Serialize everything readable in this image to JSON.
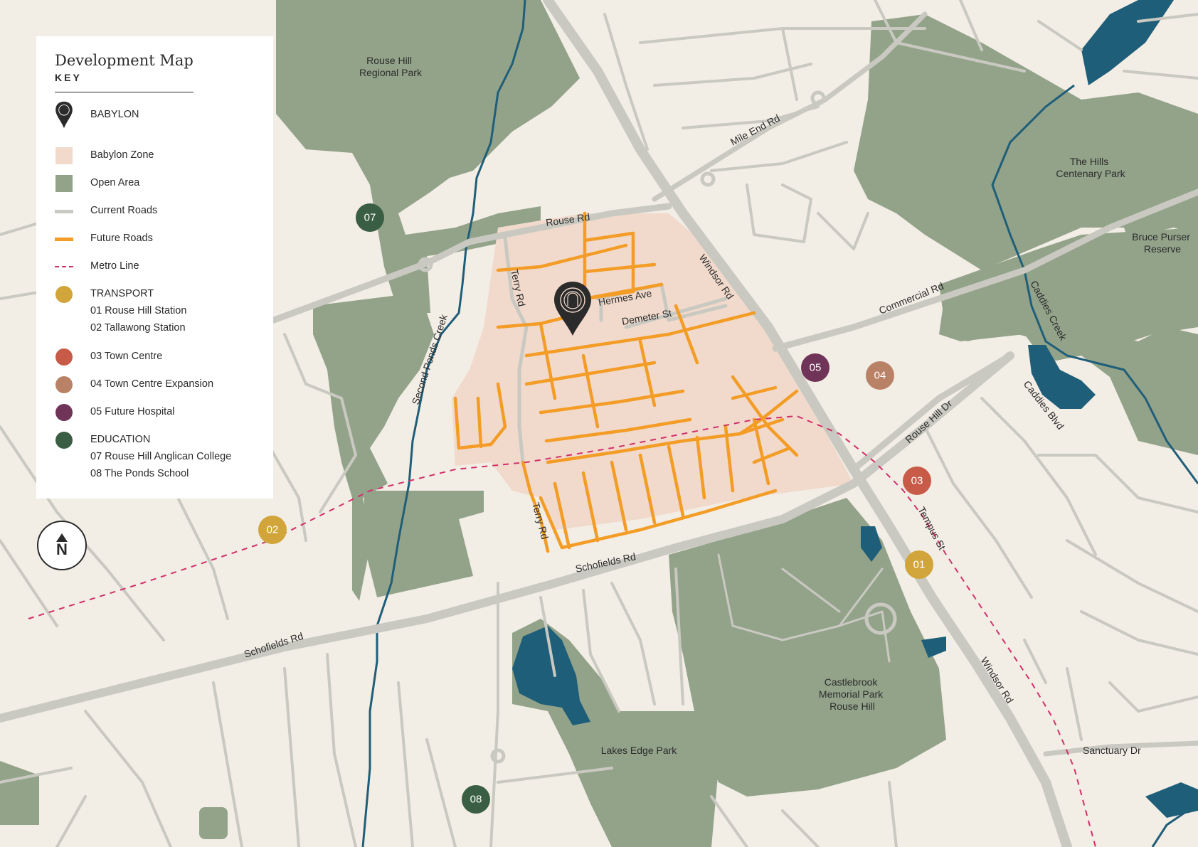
{
  "legend": {
    "title": "Development Map",
    "key_label": "KEY",
    "babylon": "BABYLON",
    "babylon_zone": "Babylon Zone",
    "open_area": "Open Area",
    "current_roads": "Current Roads",
    "future_roads": "Future Roads",
    "metro_line": "Metro Line",
    "transport": {
      "heading": "TRANSPORT",
      "items": [
        "01 Rouse Hill Station",
        "02 Tallawong Station"
      ]
    },
    "town_centre": "03 Town Centre",
    "town_centre_expansion": "04 Town Centre Expansion",
    "future_hospital": "05 Future Hospital",
    "education": {
      "heading": "EDUCATION",
      "items": [
        "07 Rouse Hill Anglican College",
        "08 The Ponds School"
      ]
    }
  },
  "colors": {
    "background": "#f2ede5",
    "open_area": "#93a38a",
    "babylon_zone": "#f1dacc",
    "current_roads": "#c9c9c1",
    "future_roads": "#f39c26",
    "water": "#1f5e79",
    "metro_line": "#d2306a",
    "transport": "#d1a53a",
    "town_centre": "#c85a48",
    "town_centre_expansion": "#b98267",
    "future_hospital": "#6f3458",
    "education": "#3a5e43"
  },
  "north_label": "N",
  "markers": [
    {
      "id": "01",
      "category": "transport"
    },
    {
      "id": "02",
      "category": "transport"
    },
    {
      "id": "03",
      "category": "town_centre"
    },
    {
      "id": "04",
      "category": "town_centre_expansion"
    },
    {
      "id": "05",
      "category": "future_hospital"
    },
    {
      "id": "07",
      "category": "education"
    },
    {
      "id": "08",
      "category": "education"
    }
  ],
  "parks": {
    "rouse_hill_regional": [
      "Rouse Hill",
      "Regional Park"
    ],
    "hills_centenary": [
      "The Hills",
      "Centenary Park"
    ],
    "bruce_purser": [
      "Bruce Purser",
      "Reserve"
    ],
    "castlebrook": [
      "Castlebrook",
      "Memorial Park",
      "Rouse Hill"
    ],
    "lakes_edge": "Lakes Edge Park"
  },
  "streets": {
    "rouse_rd": "Rouse Rd",
    "mile_end_rd": "Mile End Rd",
    "windsor_rd": "Windsor Rd",
    "commercial_rd": "Commercial Rd",
    "caddies_creek": "Caddies Creek",
    "caddies_blvd": "Caddies Blvd",
    "terry_rd": "Terry Rd",
    "hermes_ave": "Hermes Ave",
    "demeter_st": "Demeter St",
    "second_ponds_creek": "Second Ponds Creek",
    "rouse_hill_dr": "Rouse Hill Dr",
    "tempus_st": "Tempus St",
    "schofields_rd": "Schofields Rd",
    "sanctuary_dr": "Sanctuary Dr"
  }
}
